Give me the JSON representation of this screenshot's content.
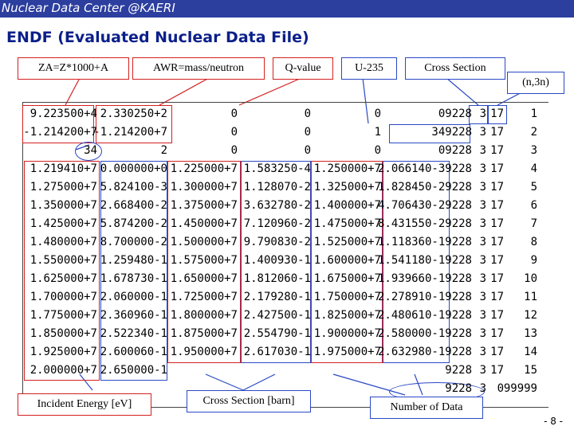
{
  "header": {
    "text": "Nuclear Data Center @KAERI"
  },
  "title": "ENDF (Evaluated Nuclear Data File)",
  "labels": {
    "za": "ZA=Z*1000+A",
    "awr": "AWR=mass/neutron",
    "q": "Q-value",
    "u235": "U-235",
    "xs": "Cross Section",
    "n3n": "(n,3n)",
    "energy": "Incident Energy [eV]",
    "xsbarn": "Cross Section [barn]",
    "ndata": "Number of Data"
  },
  "rows": [
    [
      "9.223500+4",
      "2.330250+2",
      "0",
      "0",
      "0",
      "09228",
      "3",
      "17",
      "1"
    ],
    [
      "-1.214200+7",
      "-1.214200+7",
      "0",
      "0",
      "1",
      "349228",
      "3",
      "17",
      "2"
    ],
    [
      "34",
      "2",
      "0",
      "0",
      "0",
      "09228",
      "3",
      "17",
      "3"
    ],
    [
      "1.219410+7",
      "0.000000+0",
      "1.225000+7",
      "1.583250-4",
      "1.250000+7",
      "2.066140-39228",
      "3",
      "17",
      "4"
    ],
    [
      "1.275000+7",
      "5.824100-3",
      "1.300000+7",
      "1.128070-2",
      "1.325000+7",
      "1.828450-29228",
      "3",
      "17",
      "5"
    ],
    [
      "1.350000+7",
      "2.668400-2",
      "1.375000+7",
      "3.632780-2",
      "1.400000+7",
      "4.706430-29228",
      "3",
      "17",
      "6"
    ],
    [
      "1.425000+7",
      "5.874200-2",
      "1.450000+7",
      "7.120960-2",
      "1.475000+7",
      "8.431550-29228",
      "3",
      "17",
      "7"
    ],
    [
      "1.480000+7",
      "8.700000-2",
      "1.500000+7",
      "9.790830-2",
      "1.525000+7",
      "1.118360-19228",
      "3",
      "17",
      "8"
    ],
    [
      "1.550000+7",
      "1.259480-1",
      "1.575000+7",
      "1.400930-1",
      "1.600000+7",
      "1.541180-19228",
      "3",
      "17",
      "9"
    ],
    [
      "1.625000+7",
      "1.678730-1",
      "1.650000+7",
      "1.812060-1",
      "1.675000+7",
      "1.939660-19228",
      "3",
      "17",
      "10"
    ],
    [
      "1.700000+7",
      "2.060000-1",
      "1.725000+7",
      "2.179280-1",
      "1.750000+7",
      "2.278910-19228",
      "3",
      "17",
      "11"
    ],
    [
      "1.775000+7",
      "2.360960-1",
      "1.800000+7",
      "2.427500-1",
      "1.825000+7",
      "2.480610-19228",
      "3",
      "17",
      "12"
    ],
    [
      "1.850000+7",
      "2.522340-1",
      "1.875000+7",
      "2.554790-1",
      "1.900000+7",
      "2.580000-19228",
      "3",
      "17",
      "13"
    ],
    [
      "1.925000+7",
      "2.600060-1",
      "1.950000+7",
      "2.617030-1",
      "1.975000+7",
      "2.632980-19228",
      "3",
      "17",
      "14"
    ],
    [
      "2.000000+7",
      "2.650000-1",
      "",
      "",
      "",
      "9228",
      "3",
      "17",
      "15"
    ],
    [
      "",
      "",
      "",
      "",
      "",
      "9228",
      "3",
      "0",
      "99999"
    ]
  ],
  "page_number": "- 8 -"
}
